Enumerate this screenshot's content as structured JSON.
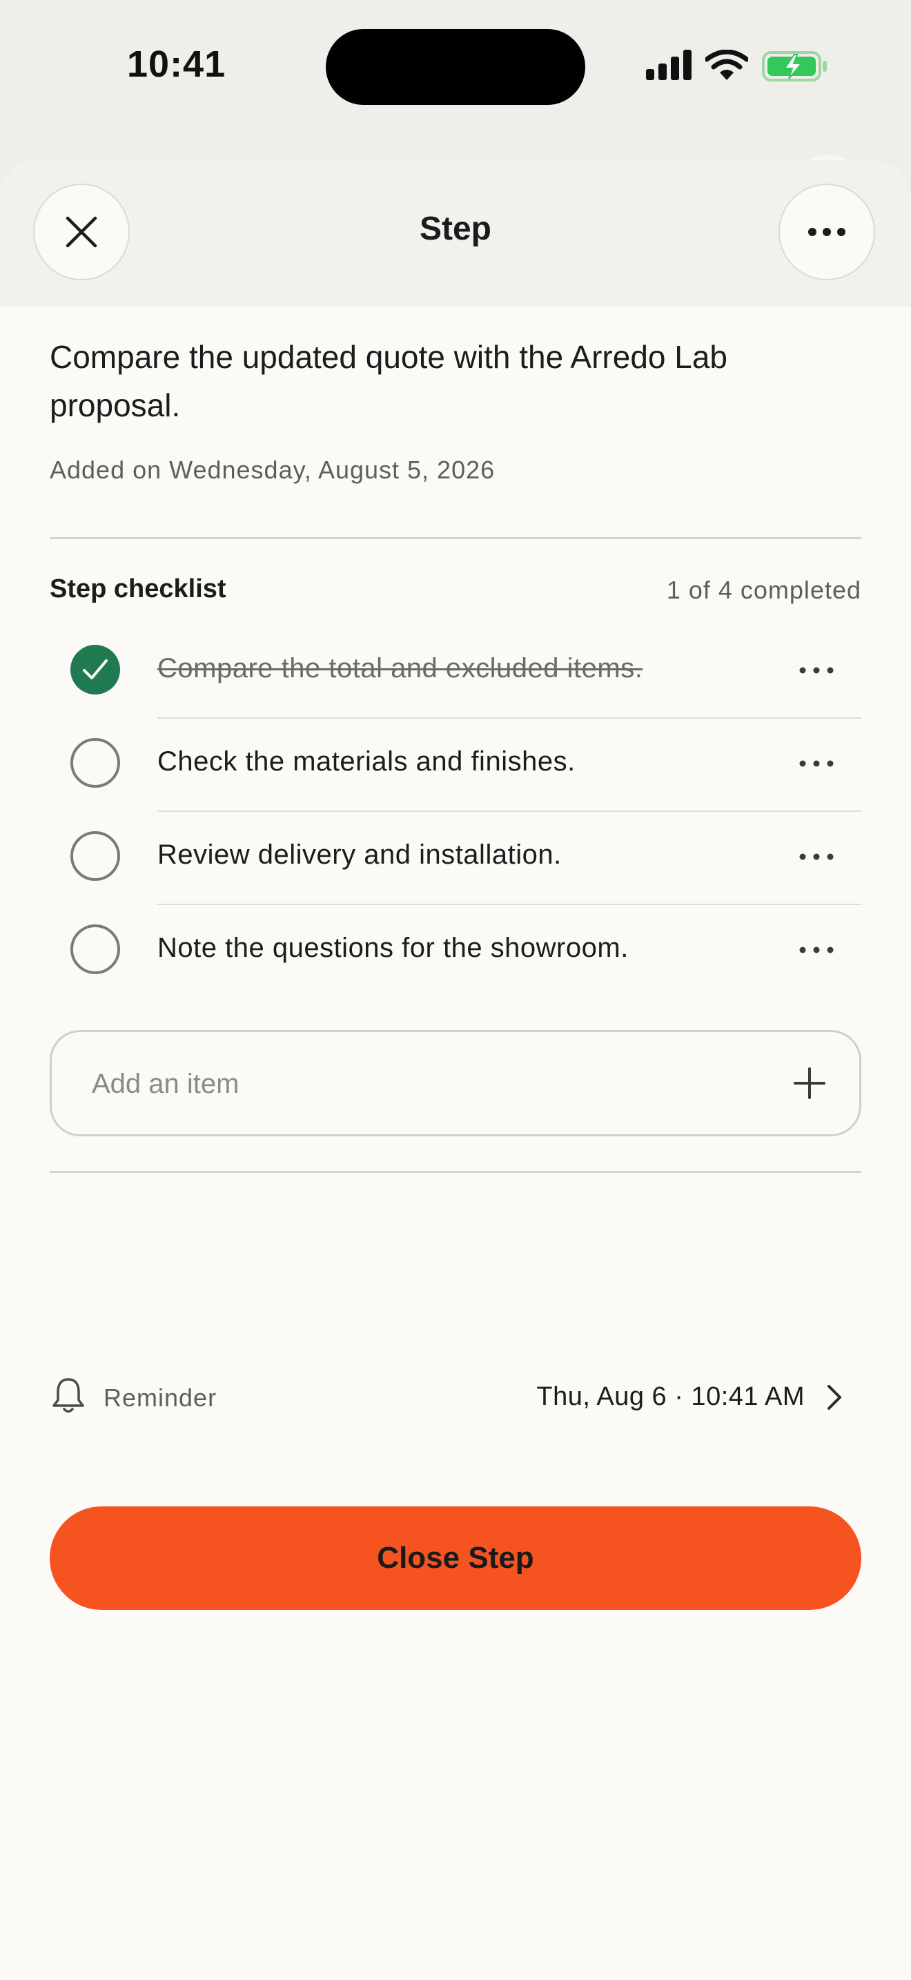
{
  "status_bar": {
    "time": "10:41"
  },
  "header": {
    "title": "Step"
  },
  "step": {
    "description": "Compare the updated quote with the Arredo Lab proposal.",
    "added": "Added on Wednesday, August 5, 2026"
  },
  "checklist": {
    "title": "Step checklist",
    "count": "1 of 4 completed",
    "items": [
      {
        "label": "Compare the total and excluded items.",
        "done": true
      },
      {
        "label": "Check the materials and finishes.",
        "done": false
      },
      {
        "label": "Review delivery and installation.",
        "done": false
      },
      {
        "label": "Note the questions for the showroom.",
        "done": false
      }
    ],
    "add_placeholder": "Add an item"
  },
  "reminder": {
    "label": "Reminder",
    "value": "Thu, Aug 6 · 10:41 AM"
  },
  "actions": {
    "close_step": "Close Step"
  },
  "colors": {
    "accent": "#f55420",
    "check_done": "#1f7a52",
    "battery": "#34c759"
  },
  "icons": [
    "close-icon",
    "more-icon",
    "check-icon",
    "plus-icon",
    "bell-icon",
    "chevron-right-icon",
    "signal-icon",
    "wifi-icon",
    "battery-charging-icon"
  ]
}
